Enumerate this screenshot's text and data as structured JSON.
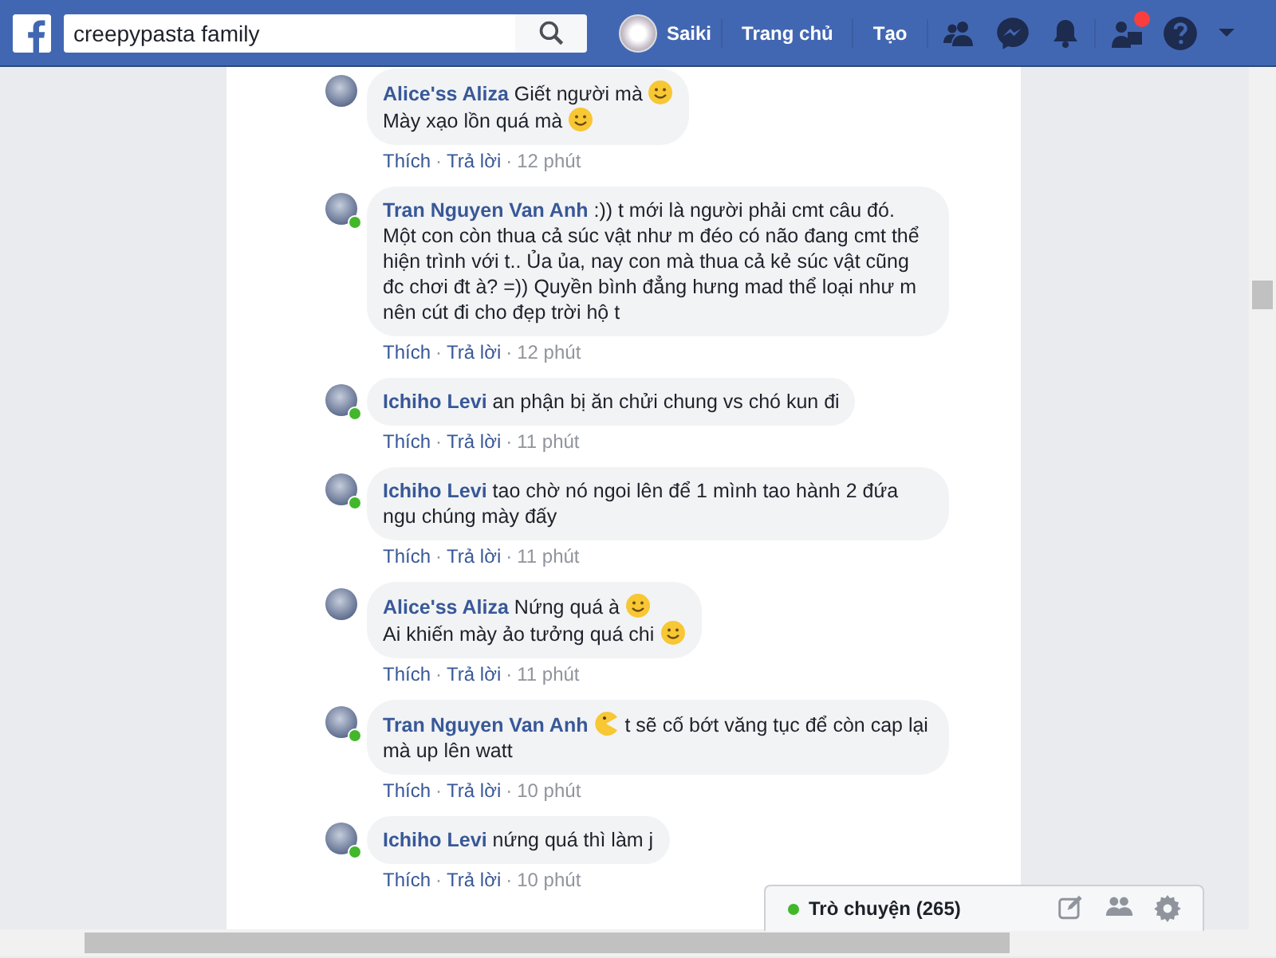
{
  "header": {
    "search": {
      "value": "creepypasta family"
    },
    "profile": {
      "name": "Saiki"
    },
    "nav": [
      "Trang chủ",
      "Tạo"
    ],
    "notifications_badge": true
  },
  "comments": [
    {
      "author": "Alice'ss Aliza",
      "online": false,
      "parts": [
        {
          "kind": "text",
          "text": "Giết người mà"
        },
        {
          "kind": "smile"
        },
        {
          "kind": "break"
        },
        {
          "kind": "text",
          "text": "Mày xạo lồn quá mà"
        },
        {
          "kind": "smile"
        }
      ],
      "meta": [
        {
          "kind": "link",
          "text": "Thích"
        },
        {
          "kind": "sep",
          "text": "·"
        },
        {
          "kind": "link",
          "text": "Trả lời"
        },
        {
          "kind": "sep",
          "text": "·"
        },
        {
          "kind": "time",
          "text": "12 phút"
        }
      ]
    },
    {
      "author": "Tran Nguyen Van Anh",
      "online": true,
      "parts": [
        {
          "kind": "text",
          "text": ":)) t mới là người phải cmt câu đó. Một con còn thua cả súc vật như m đéo có não đang cmt thể hiện trình với t.. Ủa ủa, nay con mà thua cả kẻ súc vật cũng đc chơi đt à? =)) Quyền bình đẳng hưng mad thể loại như m nên cút đi cho đẹp trời hộ t"
        }
      ],
      "meta": [
        {
          "kind": "link",
          "text": "Thích"
        },
        {
          "kind": "sep",
          "text": "·"
        },
        {
          "kind": "link",
          "text": "Trả lời"
        },
        {
          "kind": "sep",
          "text": "·"
        },
        {
          "kind": "time",
          "text": "12 phút"
        }
      ]
    },
    {
      "author": "Ichiho Levi",
      "online": true,
      "parts": [
        {
          "kind": "text",
          "text": "an phận bị ăn chửi chung vs chó kun đi"
        }
      ],
      "meta": [
        {
          "kind": "link",
          "text": "Thích"
        },
        {
          "kind": "sep",
          "text": "·"
        },
        {
          "kind": "link",
          "text": "Trả lời"
        },
        {
          "kind": "sep",
          "text": "·"
        },
        {
          "kind": "time",
          "text": "11 phút"
        }
      ]
    },
    {
      "author": "Ichiho Levi",
      "online": true,
      "parts": [
        {
          "kind": "text",
          "text": "tao chờ nó ngoi lên để 1 mình tao hành 2 đứa ngu chúng mày đấy"
        }
      ],
      "meta": [
        {
          "kind": "link",
          "text": "Thích"
        },
        {
          "kind": "sep",
          "text": "·"
        },
        {
          "kind": "link",
          "text": "Trả lời"
        },
        {
          "kind": "sep",
          "text": "·"
        },
        {
          "kind": "time",
          "text": "11 phút"
        }
      ]
    },
    {
      "author": "Alice'ss Aliza",
      "online": false,
      "parts": [
        {
          "kind": "text",
          "text": "Nứng quá à"
        },
        {
          "kind": "smile"
        },
        {
          "kind": "break"
        },
        {
          "kind": "text",
          "text": "Ai khiến mày ảo tưởng quá chi"
        },
        {
          "kind": "smile"
        }
      ],
      "meta": [
        {
          "kind": "link",
          "text": "Thích"
        },
        {
          "kind": "sep",
          "text": "·"
        },
        {
          "kind": "link",
          "text": "Trả lời"
        },
        {
          "kind": "sep",
          "text": "·"
        },
        {
          "kind": "time",
          "text": "11 phút"
        }
      ]
    },
    {
      "author": "Tran Nguyen Van Anh",
      "online": true,
      "parts": [
        {
          "kind": "pacman"
        },
        {
          "kind": "text",
          "text": "t sẽ cố bớt văng tục để còn cap lại mà up lên watt"
        }
      ],
      "meta": [
        {
          "kind": "link",
          "text": "Thích"
        },
        {
          "kind": "sep",
          "text": "·"
        },
        {
          "kind": "link",
          "text": "Trả lời"
        },
        {
          "kind": "sep",
          "text": "·"
        },
        {
          "kind": "time",
          "text": "10 phút"
        }
      ]
    },
    {
      "author": "Ichiho Levi",
      "online": true,
      "parts": [
        {
          "kind": "text",
          "text": "nứng quá thì làm j"
        }
      ],
      "meta": [
        {
          "kind": "link",
          "text": "Thích"
        },
        {
          "kind": "sep",
          "text": "·"
        },
        {
          "kind": "link",
          "text": "Trả lời"
        },
        {
          "kind": "sep",
          "text": "·"
        },
        {
          "kind": "time",
          "text": "10 phút"
        }
      ]
    }
  ],
  "chat": {
    "label": "Trò chuyện (265)",
    "online": true
  }
}
